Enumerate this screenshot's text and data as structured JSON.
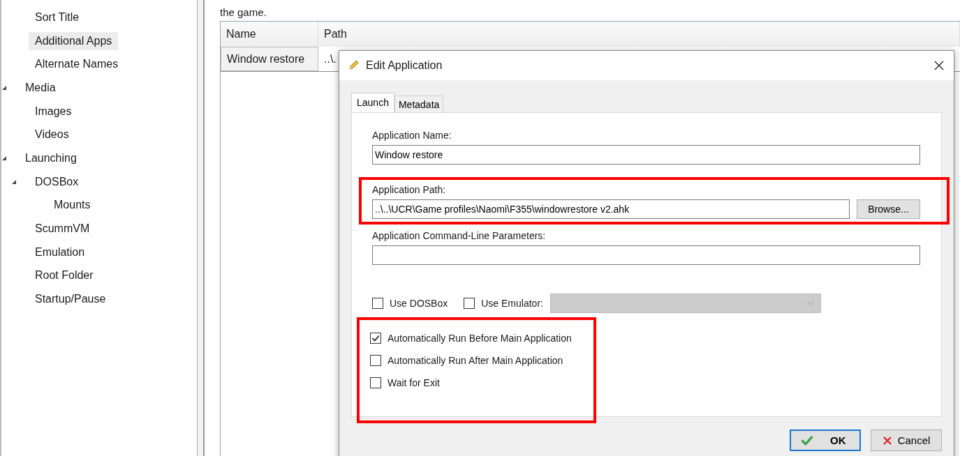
{
  "tree": [
    {
      "children": [
        {
          "label": "Sort Title",
          "selected": false
        },
        {
          "label": "Additional Apps",
          "selected": true
        },
        {
          "label": "Alternate Names",
          "selected": false
        }
      ]
    },
    {
      "label": "Media",
      "selected": false,
      "expanded": true,
      "children": [
        {
          "label": "Images",
          "selected": false
        },
        {
          "label": "Videos",
          "selected": false
        }
      ]
    },
    {
      "label": "Launching",
      "selected": false,
      "expanded": true,
      "children": [
        {
          "label": "DOSBox",
          "selected": false,
          "expanded": true,
          "children": [
            {
              "label": "Mounts",
              "selected": false
            }
          ]
        },
        {
          "label": "ScummVM",
          "selected": false
        },
        {
          "label": "Emulation",
          "selected": false
        },
        {
          "label": "Root Folder",
          "selected": false
        },
        {
          "label": "Startup/Pause",
          "selected": false
        }
      ]
    }
  ],
  "description_tail": "the game.",
  "table": {
    "columns": [
      "Name",
      "Path"
    ],
    "rows": [
      {
        "cells": [
          "Window restore",
          "..\\."
        ]
      }
    ]
  },
  "dialog": {
    "title": "Edit Application",
    "tabs": [
      {
        "label": "Launch",
        "selected": true
      },
      {
        "label": "Metadata",
        "selected": false
      }
    ],
    "name_label": "Application Name:",
    "name_value": "Window restore",
    "path_label": "Application Path:",
    "path_value": "..\\..\\UCR\\Game profiles\\Naomi\\F355\\windowrestore v2.ahk",
    "browse": "Browse...",
    "path_highlighted": true,
    "params_label": "Application Command-Line Parameters:",
    "use_dosbox": {
      "label": "Use DOSBox",
      "checked": false
    },
    "use_emulator": {
      "label": "Use Emulator:",
      "checked": false
    },
    "emulator_dropdown": {
      "disabled": true
    },
    "run_options": [
      {
        "label": "Automatically Run Before Main Application",
        "checked": true
      },
      {
        "label": "Automatically Run After Main Application",
        "checked": false
      },
      {
        "label": "Wait for Exit",
        "checked": false
      }
    ],
    "run_options_highlighted": true,
    "ok": "OK",
    "cancel": "Cancel"
  }
}
